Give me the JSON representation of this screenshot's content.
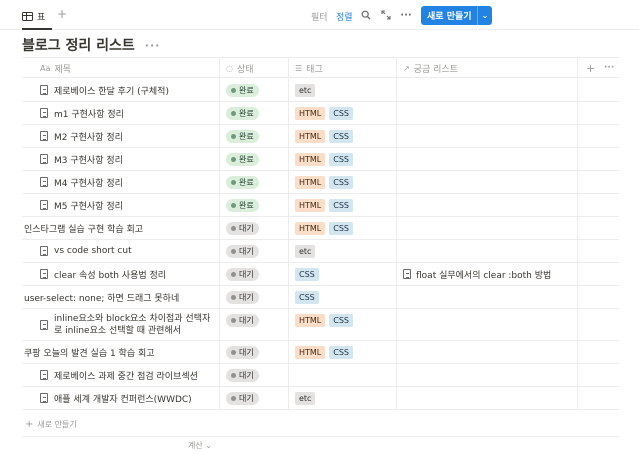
{
  "toolbar": {
    "view_tab_label": "표",
    "add_view": "+",
    "filter_label": "필터",
    "sort_label": "정렬",
    "search_icon": "🔍",
    "expand_icon": "⤡",
    "more_icon": "···",
    "new_button_label": "새로 만들기",
    "new_button_chevron": "⌄"
  },
  "database": {
    "title": "블로그 정리 리스트",
    "title_more": "···"
  },
  "columns": {
    "name": {
      "icon": "Aa",
      "label": "제목"
    },
    "status": {
      "icon": "◌",
      "label": "상태"
    },
    "tags": {
      "icon": "☰",
      "label": "태그"
    },
    "link": {
      "icon": "↗",
      "label": "궁금 리스트"
    },
    "add": "+",
    "more": "···"
  },
  "rows": [
    {
      "title": "제로베이스 한달 후기 (구체적)",
      "file": true,
      "status": "완료",
      "tags": [
        "etc"
      ],
      "link": ""
    },
    {
      "title": "m1 구현사항 정리",
      "file": true,
      "status": "완료",
      "tags": [
        "HTML",
        "CSS"
      ],
      "link": ""
    },
    {
      "title": "M2 구현사항 정리",
      "file": true,
      "status": "완료",
      "tags": [
        "HTML",
        "CSS"
      ],
      "link": ""
    },
    {
      "title": "M3 구현사항 정리",
      "file": true,
      "status": "완료",
      "tags": [
        "HTML",
        "CSS"
      ],
      "link": ""
    },
    {
      "title": "M4 구현사항 정리",
      "file": true,
      "status": "완료",
      "tags": [
        "HTML",
        "CSS"
      ],
      "link": ""
    },
    {
      "title": "M5 구현사항 정리",
      "file": true,
      "status": "완료",
      "tags": [
        "HTML",
        "CSS"
      ],
      "link": ""
    },
    {
      "title": "인스타그램 실습 구현 학습 회고",
      "file": false,
      "status": "대기",
      "tags": [
        "HTML",
        "CSS"
      ],
      "link": ""
    },
    {
      "title": "vs code short cut",
      "file": true,
      "status": "대기",
      "tags": [
        "etc"
      ],
      "link": ""
    },
    {
      "title": "clear 속성 both 사용법 정리",
      "file": true,
      "status": "대기",
      "tags": [
        "CSS"
      ],
      "link": "float 실무에서의 clear :both 방법"
    },
    {
      "title": "user-select: none; 하면 드래그 못하네",
      "file": false,
      "status": "대기",
      "tags": [
        "CSS"
      ],
      "link": ""
    },
    {
      "title": "inline요소와 block요소 차이점과 선택자로 inline요소 선택할 때 관련해서",
      "file": true,
      "status": "대기",
      "tags": [
        "HTML",
        "CSS"
      ],
      "link": ""
    },
    {
      "title": "쿠팡 오늘의 발견 실습 1 학습 회고",
      "file": false,
      "status": "대기",
      "tags": [
        "HTML",
        "CSS"
      ],
      "link": ""
    },
    {
      "title": "제로베이스 과제 중간 점검 라이브섹션",
      "file": true,
      "status": "대기",
      "tags": [],
      "link": ""
    },
    {
      "title": "애플 세계 개발자 컨퍼런스(WWDC)",
      "file": true,
      "status": "대기",
      "tags": [
        "etc"
      ],
      "link": ""
    }
  ],
  "footer": {
    "new_row_label": "새로 만들기",
    "new_row_plus": "+",
    "calculate_label": "계산 ⌄"
  }
}
